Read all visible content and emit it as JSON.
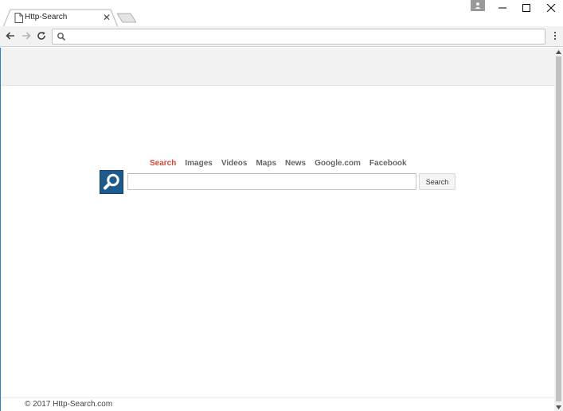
{
  "tab": {
    "title": "Http-Search",
    "close_glyph": "✕"
  },
  "omnibox": {
    "value": "",
    "placeholder": ""
  },
  "search": {
    "links": [
      {
        "label": "Search",
        "active": true
      },
      {
        "label": "Images",
        "active": false
      },
      {
        "label": "Videos",
        "active": false
      },
      {
        "label": "Maps",
        "active": false
      },
      {
        "label": "News",
        "active": false
      },
      {
        "label": "Google.com",
        "active": false
      },
      {
        "label": "Facebook",
        "active": false
      }
    ],
    "query_value": "",
    "button_label": "Search"
  },
  "footer": {
    "text": "© 2017 Http-Search.com"
  },
  "icons": {
    "tab_favicon": "page-icon",
    "back": "arrow-left-icon",
    "forward": "arrow-right-icon",
    "reload": "reload-icon",
    "omnibox": "search-icon",
    "menu": "vertical-dots-icon",
    "logo": "magnifier-icon"
  },
  "colors": {
    "active_link": "#d14836",
    "link": "#666666",
    "logo_bg": "#1f5a8d",
    "page_header_bg": "#f2f2f2",
    "page_left_border": "#2a7fd0"
  }
}
